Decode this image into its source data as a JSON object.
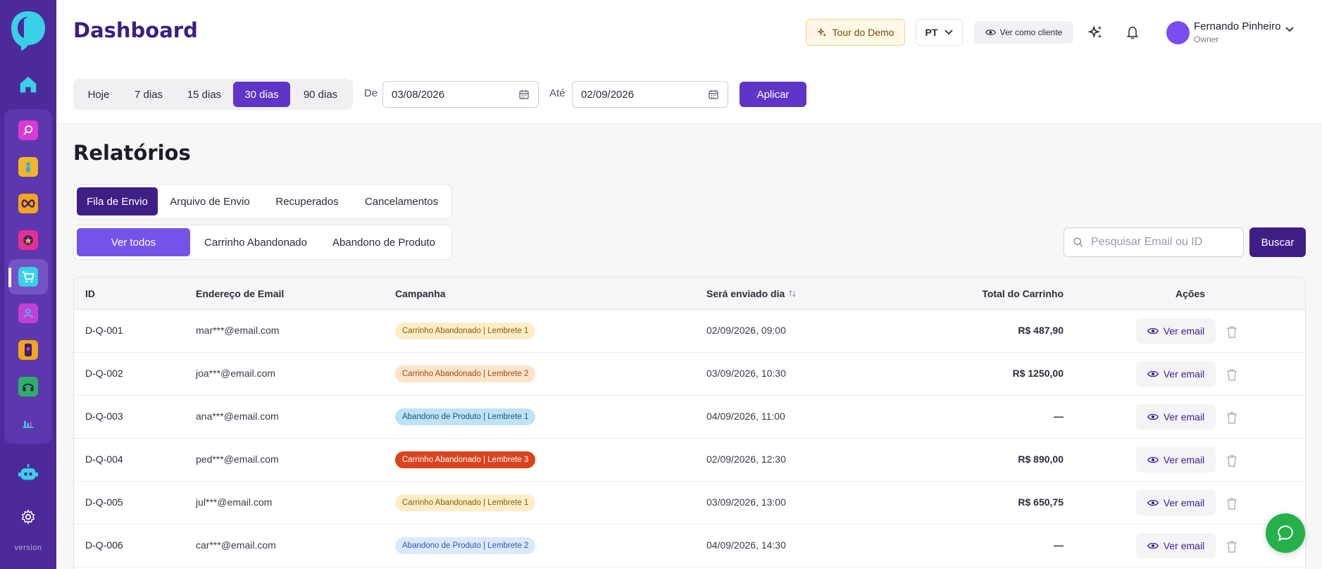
{
  "sidebar": {
    "version": "version",
    "items": [
      "home-icon",
      "search-icon",
      "person-icon",
      "infinity-icon",
      "star-icon",
      "cart-icon",
      "user-icon",
      "phone-icon",
      "headset-icon",
      "bar-chart-icon",
      "robot-icon",
      "gear-icon"
    ]
  },
  "header": {
    "title": "Dashboard",
    "tour_label": "Tour do Demo",
    "lang_label": "PT",
    "client_label": "Ver como cliente",
    "user_name": "Fernando Pinheiro",
    "user_role": "Owner",
    "ranges": [
      "Hoje",
      "7 dias",
      "15 dias",
      "30 dias",
      "90 dias"
    ],
    "active_range": "30 dias",
    "from_label": "De",
    "from_date": "03/08/2026",
    "to_label": "Até",
    "to_date": "02/09/2026",
    "apply_label": "Aplicar"
  },
  "content": {
    "title": "Relatórios",
    "tabs": [
      "Fila de Envio",
      "Arquivo de Envio",
      "Recuperados",
      "Cancelamentos"
    ],
    "active_tab": "Fila de Envio",
    "filters": [
      "Ver todos",
      "Carrinho Abandonado",
      "Abandono de Produto"
    ],
    "active_filter": "Ver todos",
    "search_placeholder": "Pesquisar Email ou ID",
    "search_label": "Buscar"
  },
  "table": {
    "columns": [
      "ID",
      "Endereço de Email",
      "Campanha",
      "Será enviado dia",
      "Total do Carrinho",
      "Ações"
    ],
    "view_label": "Ver email",
    "rows": [
      {
        "id": "D-Q-001",
        "email": "mar***@email.com",
        "campaign": "Carrinho Abandonado | Lembrete 1",
        "date": "02/09/2026, 09:00",
        "total": "R$ 487,90"
      },
      {
        "id": "D-Q-002",
        "email": "joa***@email.com",
        "campaign": "Carrinho Abandonado | Lembrete 2",
        "date": "03/09/2026, 10:30",
        "total": "R$ 1250,00"
      },
      {
        "id": "D-Q-003",
        "email": "ana***@email.com",
        "campaign": "Abandono de Produto | Lembrete 1",
        "date": "04/09/2026, 11:00",
        "total": "—"
      },
      {
        "id": "D-Q-004",
        "email": "ped***@email.com",
        "campaign": "Carrinho Abandonado | Lembrete 3",
        "date": "02/09/2026, 12:30",
        "total": "R$ 890,00"
      },
      {
        "id": "D-Q-005",
        "email": "jul***@email.com",
        "campaign": "Carrinho Abandonado | Lembrete 1",
        "date": "03/09/2026, 13:00",
        "total": "R$ 650,75"
      },
      {
        "id": "D-Q-006",
        "email": "car***@email.com",
        "campaign": "Abandono de Produto | Lembrete 2",
        "date": "04/09/2026, 14:30",
        "total": "—"
      }
    ]
  },
  "colors": {
    "brand": "#4c2a99",
    "accent": "#5e35c7",
    "badge_reminder1": "#fdeec8",
    "badge_reminder2": "#fbe3cc",
    "badge_reminder3": "#d9431e",
    "badge_product1": "#bfe3f5",
    "badge_product2": "#dbe9fb",
    "chat": "#25b04c"
  }
}
